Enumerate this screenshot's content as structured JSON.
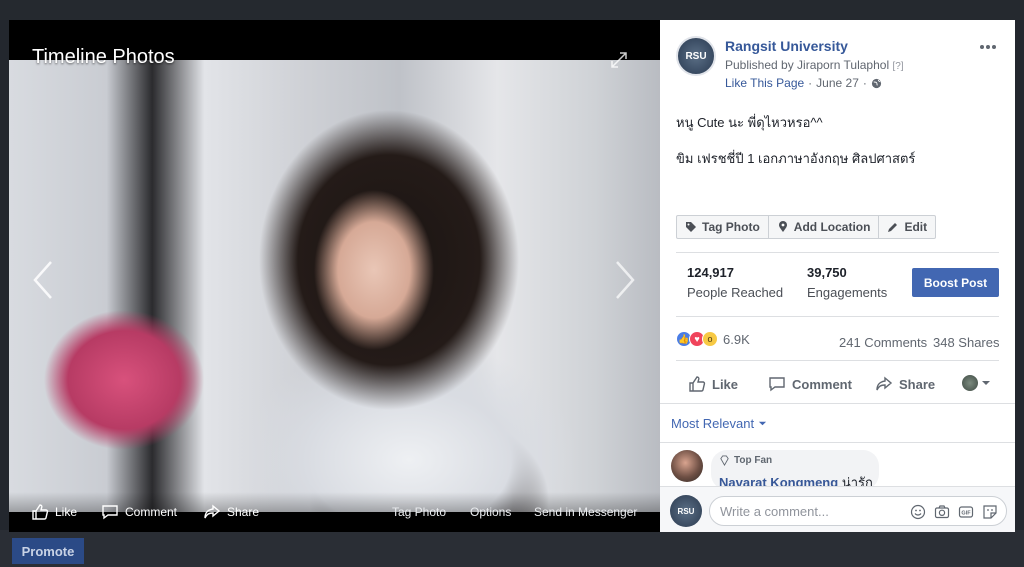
{
  "viewer": {
    "title": "Timeline Photos",
    "actions": {
      "like": "Like",
      "comment": "Comment",
      "share": "Share",
      "tag_photo": "Tag Photo",
      "options": "Options",
      "send_messenger": "Send in Messenger"
    }
  },
  "background": {
    "promote_label": "Promote"
  },
  "post": {
    "avatar_text": "RSU",
    "page_name": "Rangsit University",
    "published_by": "Published by Jiraporn Tulaphol",
    "published_help": "[?]",
    "like_page": "Like This Page",
    "date_sep": "·",
    "date": "June 27",
    "date_sep2": "·",
    "caption_line1": "หนู Cute นะ พี่ดุไหวหรอ^^",
    "caption_line2": "ขิม เฟรชชี่ปี 1 เอกภาษาอังกฤษ ศิลปศาสตร์",
    "tag_buttons": {
      "tag_photo": "Tag Photo",
      "add_location": "Add Location",
      "edit": "Edit"
    },
    "stats": {
      "people_reached_value": "124,917",
      "people_reached_label": "People Reached",
      "engagements_value": "39,750",
      "engagements_label": "Engagements",
      "boost_label": "Boost Post"
    },
    "reactions_count": "6.9K",
    "comments_count": "241 Comments",
    "shares_count": "348 Shares",
    "actions": {
      "like": "Like",
      "comment": "Comment",
      "share": "Share"
    },
    "sort_label": "Most Relevant",
    "top_comment": {
      "badge": "Top Fan",
      "author": "Navarat Kongmeng",
      "text": "น่ารัก"
    },
    "composer": {
      "avatar_text": "RSU",
      "placeholder": "Write a comment..."
    }
  },
  "colors": {
    "brand_blue": "#4267b2",
    "link_blue": "#365899",
    "background": "#1b1e24"
  }
}
